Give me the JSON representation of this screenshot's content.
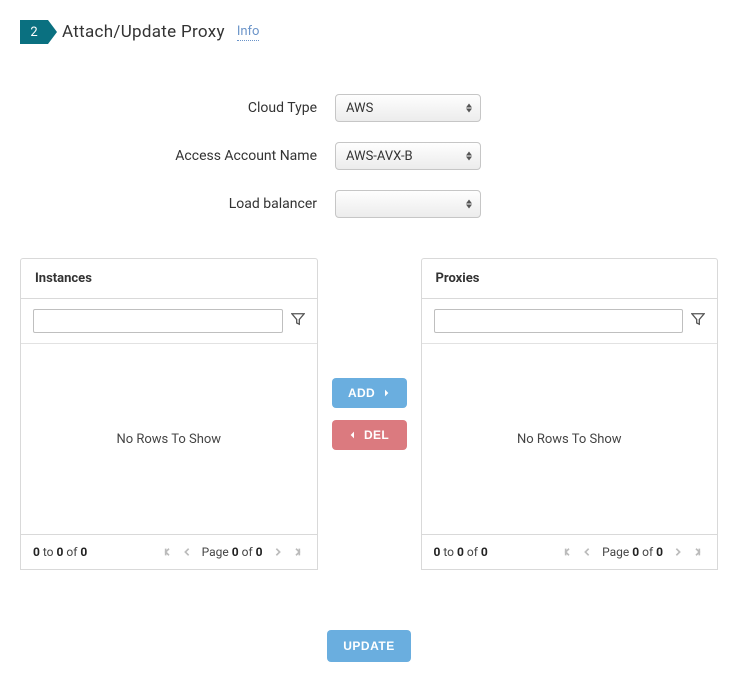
{
  "header": {
    "step": "2",
    "title": "Attach/Update Proxy",
    "info_link": "Info"
  },
  "form": {
    "cloud_type": {
      "label": "Cloud Type",
      "value": "AWS"
    },
    "access_account": {
      "label": "Access Account Name",
      "value": "AWS-AVX-B"
    },
    "load_balancer": {
      "label": "Load balancer",
      "value": ""
    }
  },
  "instances": {
    "title": "Instances",
    "search_value": "",
    "empty_text": "No Rows To Show",
    "footer": {
      "from": "0",
      "to": "0",
      "total": "0",
      "page_current": "0",
      "page_total": "0"
    }
  },
  "proxies": {
    "title": "Proxies",
    "search_value": "",
    "empty_text": "No Rows To Show",
    "footer": {
      "from": "0",
      "to": "0",
      "total": "0",
      "page_current": "0",
      "page_total": "0"
    }
  },
  "buttons": {
    "add": "ADD",
    "del": "DEL",
    "update": "UPDATE"
  }
}
